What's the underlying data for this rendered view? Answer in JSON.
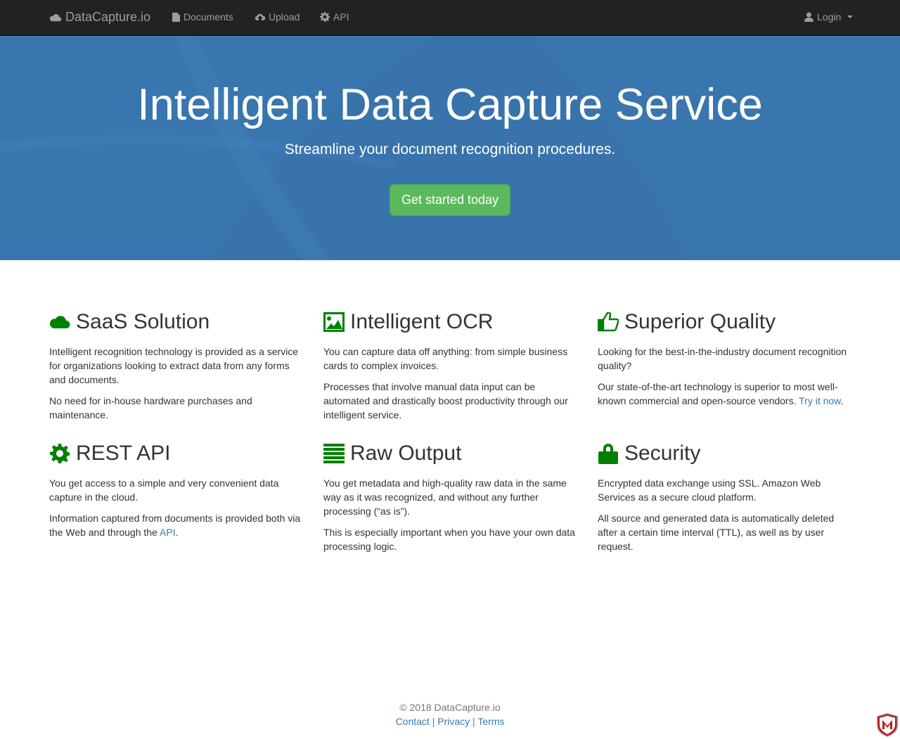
{
  "navbar": {
    "brand": "DataCapture.io",
    "links": [
      {
        "label": "Documents",
        "icon": "file-icon"
      },
      {
        "label": "Upload",
        "icon": "cloud-upload-icon"
      },
      {
        "label": "API",
        "icon": "gear-icon"
      }
    ],
    "login": {
      "label": "Login",
      "icon": "user-icon"
    }
  },
  "hero": {
    "title": "Intelligent Data Capture Service",
    "subtitle": "Streamline your document recognition procedures.",
    "cta": "Get started today",
    "bg_color": "#3873ab",
    "cta_color": "#5cb85c"
  },
  "features": [
    {
      "title": "SaaS Solution",
      "icon": "cloud-icon",
      "p1": "Intelligent recognition technology is provided as a service for organizations looking to extract data from any forms and documents.",
      "p2": "No need for in-house hardware purchases and maintenance."
    },
    {
      "title": "Intelligent OCR",
      "icon": "picture-icon",
      "p1": "You can capture data off anything: from simple business cards to complex invoices.",
      "p2": "Processes that involve manual data input can be automated and drastically boost productivity through our intelligent service."
    },
    {
      "title": "Superior Quality",
      "icon": "thumbs-up-icon",
      "p1": "Looking for the best-in-the-industry document recognition quality?",
      "p2_before": "Our state-of-the-art technology is superior to most well-known commercial and open-source vendors. ",
      "p2_link": "Try it now",
      "p2_after": "."
    },
    {
      "title": "REST API",
      "icon": "cog-icon",
      "p1": "You get access to a simple and very convenient data capture in the cloud.",
      "p2_before": "Information captured from documents is provided both via the Web and through the ",
      "p2_link": "API",
      "p2_after": "."
    },
    {
      "title": "Raw Output",
      "icon": "list-icon",
      "p1": "You get metadata and high-quality raw data in the same way as it was recognized, and without any further processing (“as is”).",
      "p2": "This is especially important when you have your own data processing logic."
    },
    {
      "title": "Security",
      "icon": "lock-icon",
      "p1": "Encrypted data exchange using SSL. Amazon Web Services as a secure cloud platform.",
      "p2": "All source and generated data is automatically deleted after a certain time interval (TTL), as well as by user request."
    }
  ],
  "footer": {
    "copyright": "© 2018 DataCapture.io",
    "links": [
      "Contact",
      "Privacy",
      "Terms"
    ],
    "separator": "|"
  },
  "colors": {
    "icon_green": "#008000",
    "link_blue": "#337ab7",
    "navbar": "#222222"
  }
}
